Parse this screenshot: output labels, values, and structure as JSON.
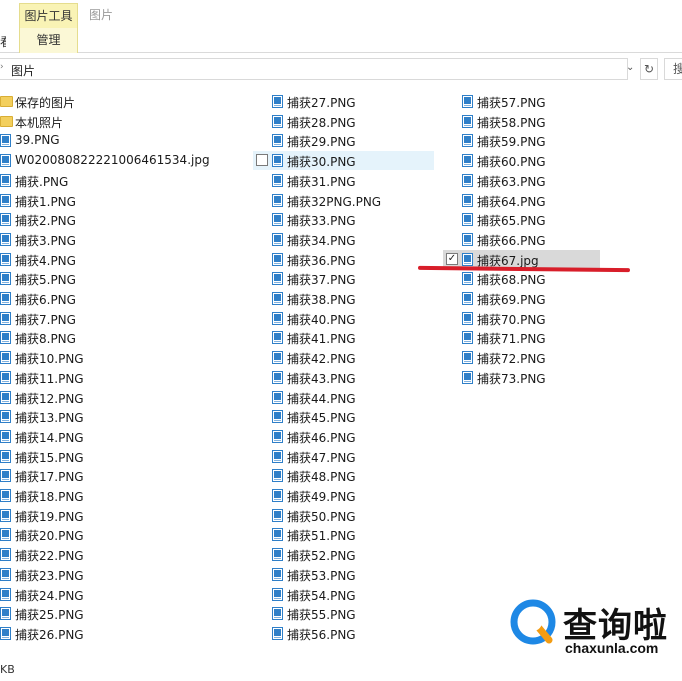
{
  "ribbon": {
    "context_tab": "图片工具",
    "context_sub": "管理",
    "title": "图片",
    "cut_left_label": "看"
  },
  "address": {
    "path": "图片",
    "search_cut": "搜"
  },
  "columns": [
    [
      {
        "name": "保存的图片",
        "type": "folder"
      },
      {
        "name": "本机照片",
        "type": "folder"
      },
      {
        "name": "39.PNG",
        "type": "image"
      },
      {
        "name": "W020080822221006461534.jpg",
        "type": "image"
      },
      {
        "name": "捕获.PNG",
        "type": "image"
      },
      {
        "name": "捕获1.PNG",
        "type": "image"
      },
      {
        "name": "捕获2.PNG",
        "type": "image"
      },
      {
        "name": "捕获3.PNG",
        "type": "image"
      },
      {
        "name": "捕获4.PNG",
        "type": "image"
      },
      {
        "name": "捕获5.PNG",
        "type": "image"
      },
      {
        "name": "捕获6.PNG",
        "type": "image"
      },
      {
        "name": "捕获7.PNG",
        "type": "image"
      },
      {
        "name": "捕获8.PNG",
        "type": "image"
      },
      {
        "name": "捕获10.PNG",
        "type": "image"
      },
      {
        "name": "捕获11.PNG",
        "type": "image"
      },
      {
        "name": "捕获12.PNG",
        "type": "image"
      },
      {
        "name": "捕获13.PNG",
        "type": "image"
      },
      {
        "name": "捕获14.PNG",
        "type": "image"
      },
      {
        "name": "捕获15.PNG",
        "type": "image"
      },
      {
        "name": "捕获17.PNG",
        "type": "image"
      },
      {
        "name": "捕获18.PNG",
        "type": "image"
      },
      {
        "name": "捕获19.PNG",
        "type": "image"
      },
      {
        "name": "捕获20.PNG",
        "type": "image"
      },
      {
        "name": "捕获22.PNG",
        "type": "image"
      },
      {
        "name": "捕获23.PNG",
        "type": "image"
      },
      {
        "name": "捕获24.PNG",
        "type": "image"
      },
      {
        "name": "捕获25.PNG",
        "type": "image"
      },
      {
        "name": "捕获26.PNG",
        "type": "image"
      }
    ],
    [
      {
        "name": "捕获27.PNG",
        "type": "image"
      },
      {
        "name": "捕获28.PNG",
        "type": "image"
      },
      {
        "name": "捕获29.PNG",
        "type": "image"
      },
      {
        "name": "捕获30.PNG",
        "type": "image",
        "hover": true
      },
      {
        "name": "捕获31.PNG",
        "type": "image"
      },
      {
        "name": "捕获32PNG.PNG",
        "type": "image"
      },
      {
        "name": "捕获33.PNG",
        "type": "image"
      },
      {
        "name": "捕获34.PNG",
        "type": "image"
      },
      {
        "name": "捕获36.PNG",
        "type": "image"
      },
      {
        "name": "捕获37.PNG",
        "type": "image"
      },
      {
        "name": "捕获38.PNG",
        "type": "image"
      },
      {
        "name": "捕获40.PNG",
        "type": "image"
      },
      {
        "name": "捕获41.PNG",
        "type": "image"
      },
      {
        "name": "捕获42.PNG",
        "type": "image"
      },
      {
        "name": "捕获43.PNG",
        "type": "image"
      },
      {
        "name": "捕获44.PNG",
        "type": "image"
      },
      {
        "name": "捕获45.PNG",
        "type": "image"
      },
      {
        "name": "捕获46.PNG",
        "type": "image"
      },
      {
        "name": "捕获47.PNG",
        "type": "image"
      },
      {
        "name": "捕获48.PNG",
        "type": "image"
      },
      {
        "name": "捕获49.PNG",
        "type": "image"
      },
      {
        "name": "捕获50.PNG",
        "type": "image"
      },
      {
        "name": "捕获51.PNG",
        "type": "image"
      },
      {
        "name": "捕获52.PNG",
        "type": "image"
      },
      {
        "name": "捕获53.PNG",
        "type": "image"
      },
      {
        "name": "捕获54.PNG",
        "type": "image"
      },
      {
        "name": "捕获55.PNG",
        "type": "image"
      },
      {
        "name": "捕获56.PNG",
        "type": "image"
      }
    ],
    [
      {
        "name": "捕获57.PNG",
        "type": "image"
      },
      {
        "name": "捕获58.PNG",
        "type": "image"
      },
      {
        "name": "捕获59.PNG",
        "type": "image"
      },
      {
        "name": "捕获60.PNG",
        "type": "image"
      },
      {
        "name": "捕获63.PNG",
        "type": "image"
      },
      {
        "name": "捕获64.PNG",
        "type": "image"
      },
      {
        "name": "捕获65.PNG",
        "type": "image"
      },
      {
        "name": "捕获66.PNG",
        "type": "image"
      },
      {
        "name": "捕获67.jpg",
        "type": "image",
        "selected": true
      },
      {
        "name": "捕获68.PNG",
        "type": "image"
      },
      {
        "name": "捕获69.PNG",
        "type": "image"
      },
      {
        "name": "捕获70.PNG",
        "type": "image"
      },
      {
        "name": "捕获71.PNG",
        "type": "image"
      },
      {
        "name": "捕获72.PNG",
        "type": "image"
      },
      {
        "name": "捕获73.PNG",
        "type": "image"
      }
    ]
  ],
  "status": {
    "size_text": "KB"
  },
  "watermark": {
    "cn": "查询啦",
    "en": "chaxunla.com"
  },
  "colors": {
    "annotation_line": "#d81e2a",
    "selection": "#d9d9d9",
    "hover": "#e5f3fb",
    "context_tab": "#f9f3b5",
    "image_icon": "#2f7fc8",
    "folder_icon": "#f3cf5d",
    "logo_blue": "#1e88e5",
    "logo_orange": "#f39c12"
  }
}
